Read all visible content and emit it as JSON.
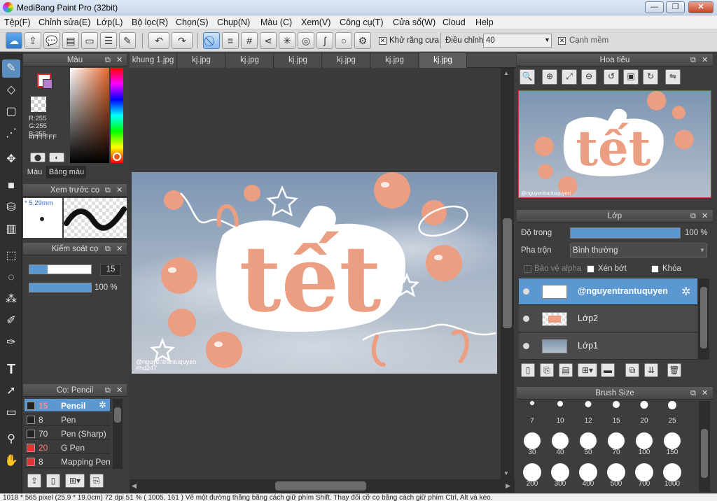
{
  "window": {
    "title": "MediBang Paint Pro (32bit)",
    "minimize": "—",
    "restore": "❐",
    "close": "✕"
  },
  "menu": [
    "Tệp(F)",
    "Chỉnh sửa(E)",
    "Lớp(L)",
    "Bộ lọc(R)",
    "Chọn(S)",
    "Chụp(N)",
    "Màu (C)",
    "Xem(V)",
    "Công cụ(T)",
    "Cửa sổ(W)",
    "Cloud",
    "Help"
  ],
  "toolbar": {
    "antialias_label": "Khử răng cưa",
    "correction_label": "Điều chỉnh",
    "correction_value": "40",
    "soft_edge_label": "Cạnh mềm",
    "check": "✕"
  },
  "color_panel": {
    "title": "Màu",
    "r": "R:255",
    "g": "G:255",
    "b": "B:255",
    "hex": "#FFFFFF",
    "tab_color": "Màu",
    "tab_palette": "Bảng màu"
  },
  "preview_panel": {
    "title": "Xem trước cọ",
    "size": "5.29mm"
  },
  "brush_control": {
    "title": "Kiểm soát cọ",
    "size_value": "15",
    "opacity_value": "100 %",
    "size_fill": 0.3,
    "opacity_fill": 1.0
  },
  "brush_panel": {
    "title": "Cọ: Pencil",
    "items": [
      {
        "size": "15",
        "name": "Pencil",
        "color": "#222222",
        "selected": true
      },
      {
        "size": "8",
        "name": "Pen",
        "color": "#222222"
      },
      {
        "size": "70",
        "name": "Pen (Sharp)",
        "color": "#222222"
      },
      {
        "size": "20",
        "name": "G Pen",
        "color": "#e03333"
      },
      {
        "size": "8",
        "name": "Mapping Pen",
        "color": "#e03333"
      }
    ]
  },
  "tabs": [
    "khung 1.jpg",
    "kj.jpg",
    "kj.jpg",
    "kj.jpg",
    "kj.jpg",
    "kj.jpg",
    "kj.jpg"
  ],
  "canvas": {
    "title_text": "tết",
    "watermark_line1": "@nguyentrantuquyen",
    "watermark_line2": "#hd247",
    "colors": {
      "sky_top": "#8ea3bc",
      "sky_bottom": "#b8c3cf",
      "peach": "#ec9e82",
      "white": "#ffffff"
    }
  },
  "navigator": {
    "title": "Hoa tiêu",
    "watermark": "@nguyentrantuquyen"
  },
  "layer_panel": {
    "title": "Lớp",
    "opacity_label": "Độ trong",
    "opacity_value": "100 %",
    "opacity_fill": 1.0,
    "blend_label": "Pha trộn",
    "blend_value": "Bình thường",
    "protect_alpha": "Bảo vệ alpha",
    "clipping": "Xén bớt",
    "lock": "Khóa",
    "layers": [
      {
        "name": "@nguyentrantuquyen",
        "selected": true
      },
      {
        "name": "Lớp2"
      },
      {
        "name": "Lớp1"
      }
    ]
  },
  "brush_size_panel": {
    "title": "Brush Size",
    "sizes": [
      "7",
      "10",
      "12",
      "15",
      "20",
      "25",
      "30",
      "40",
      "50",
      "70",
      "100",
      "150",
      "200",
      "300",
      "400",
      "500",
      "700",
      "1000"
    ]
  },
  "status": "1018 * 565 pixel  (25.9 * 19.0cm)  72 dpi  51 %  ( 1005, 161 )  Vẽ một đường thẳng bằng cách giữ phím Shift. Thay đổi cỡ cọ bằng cách giữ phím Ctrl, Alt và kéo."
}
